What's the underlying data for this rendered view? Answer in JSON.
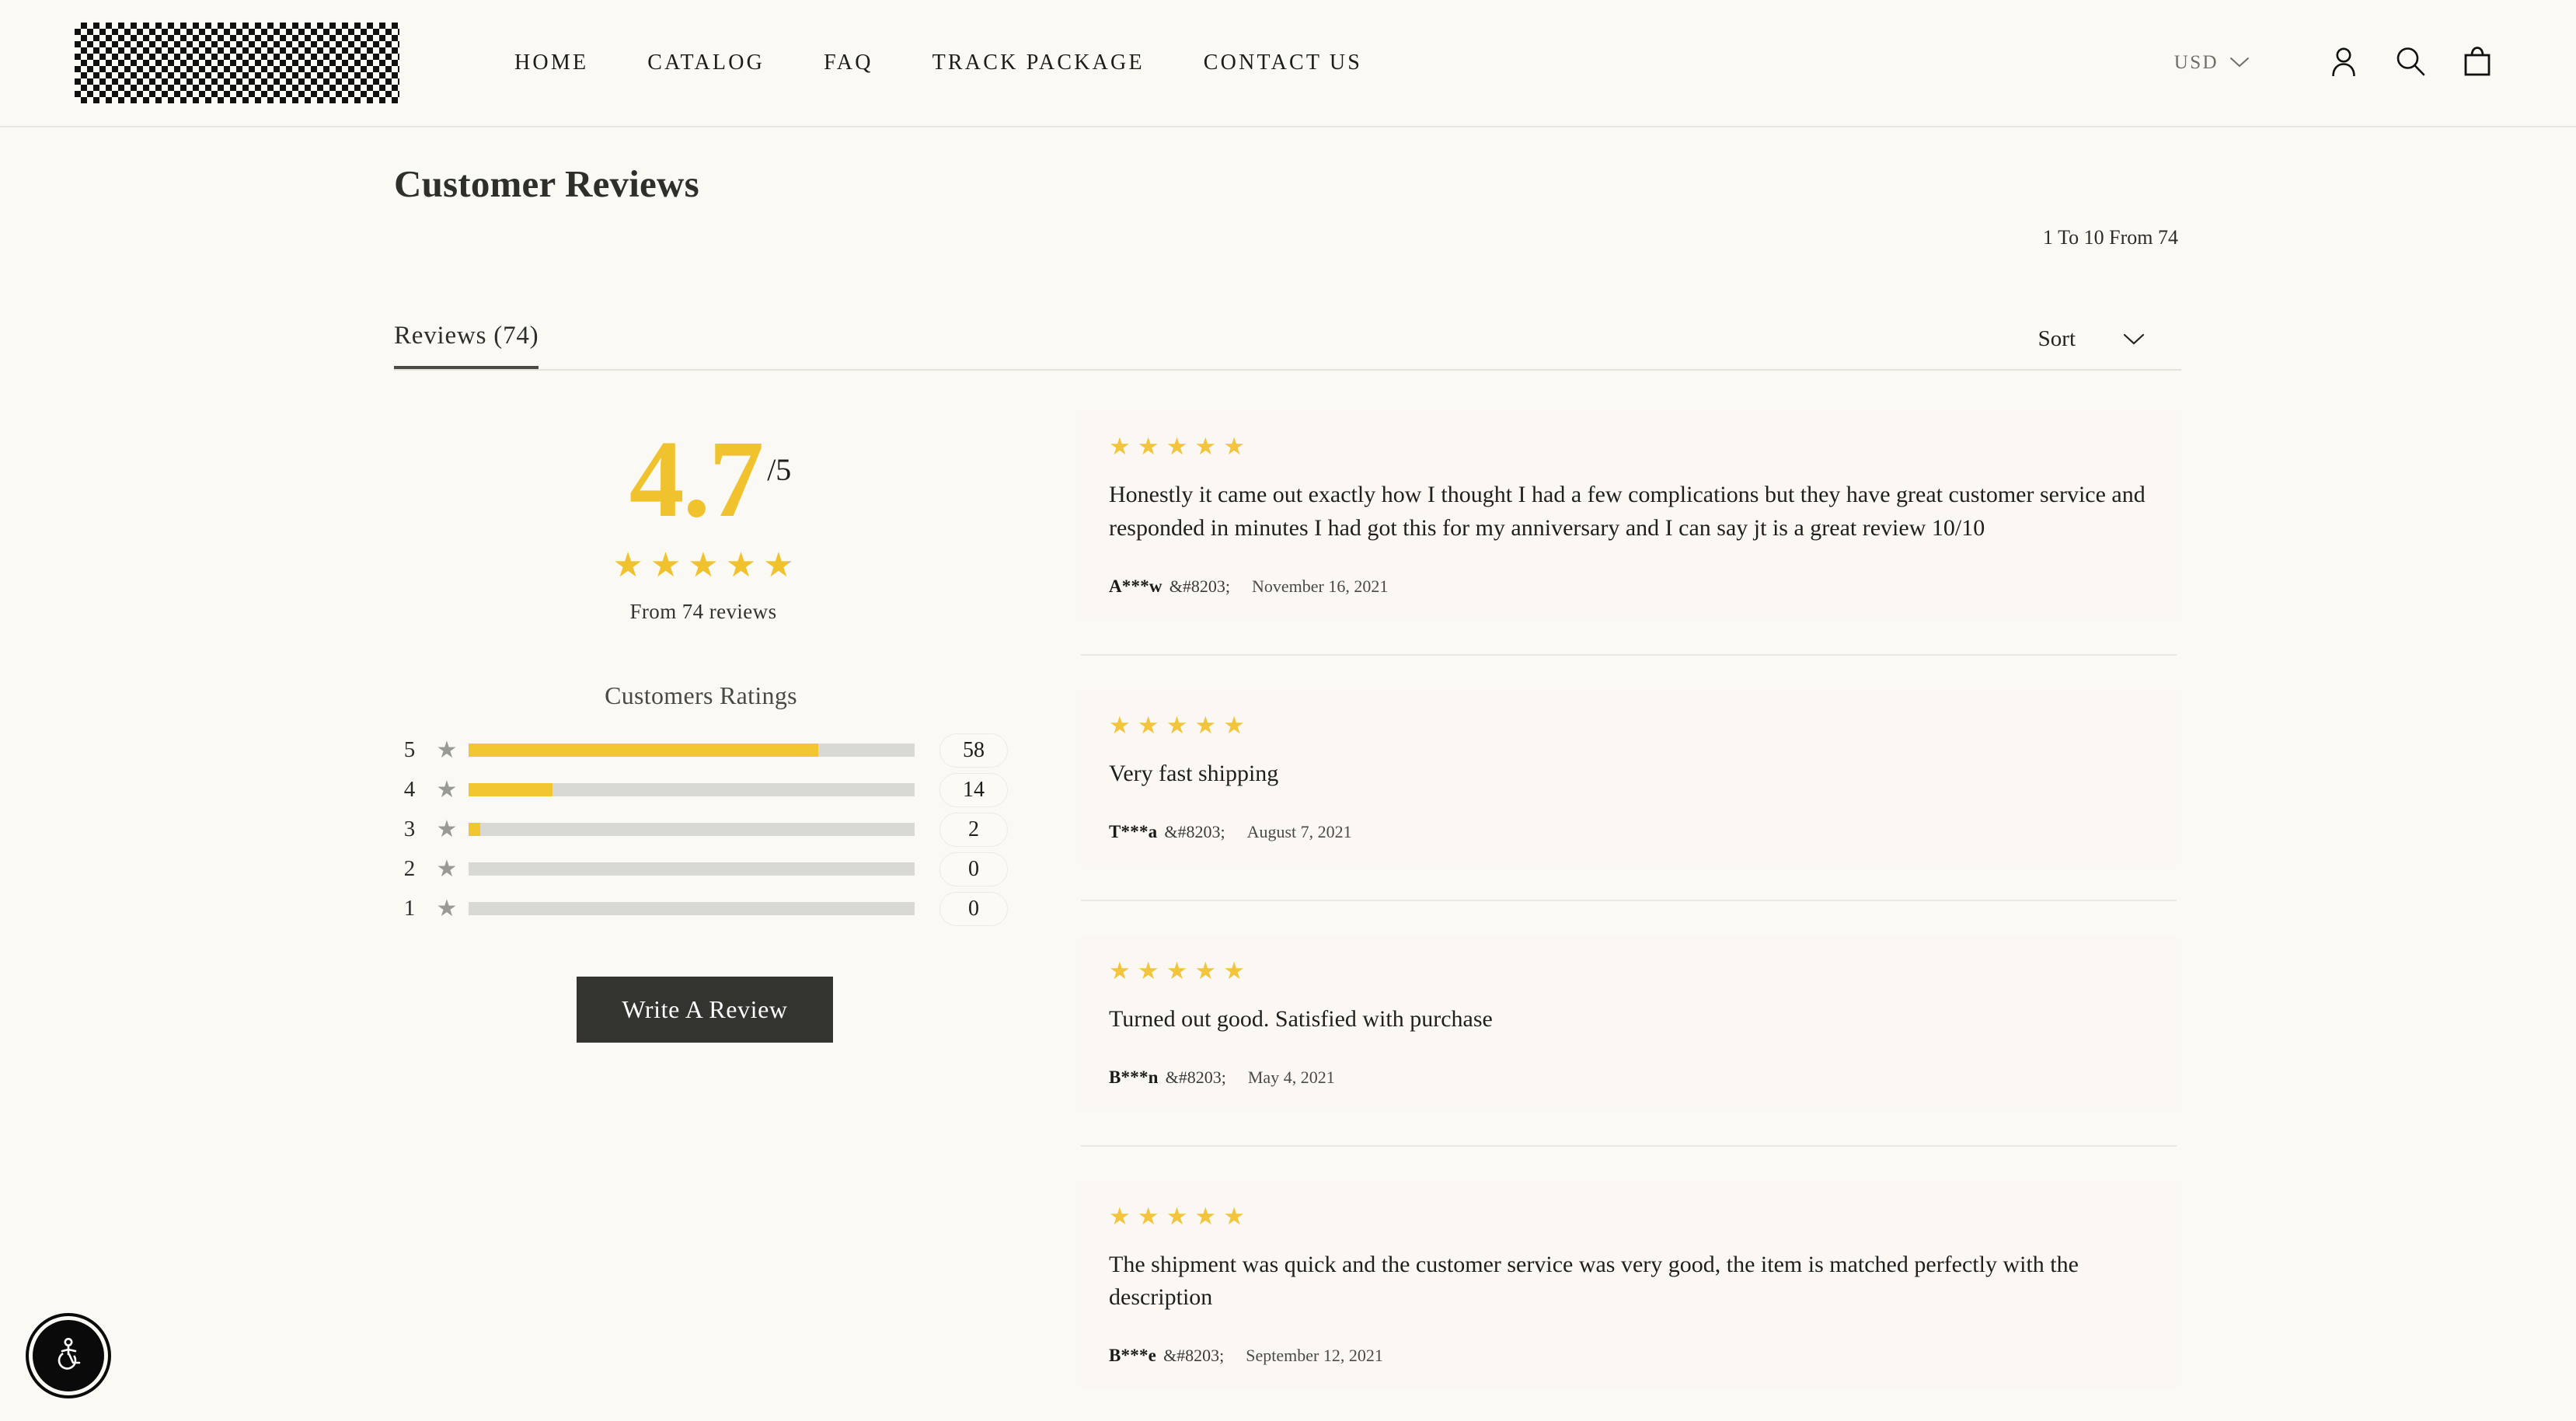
{
  "header": {
    "logo_alt": "store-logo",
    "nav": [
      {
        "label": "HOME"
      },
      {
        "label": "CATALOG"
      },
      {
        "label": "FAQ"
      },
      {
        "label": "TRACK PACKAGE"
      },
      {
        "label": "CONTACT US"
      }
    ],
    "currency": "USD",
    "icons": {
      "account": "account-icon",
      "search": "search-icon",
      "cart": "shopping-bag-icon",
      "chevron": "chevron-down-icon"
    }
  },
  "page": {
    "title": "Customer Reviews",
    "pagination_label": "1 To 10 From 74",
    "tab_label": "Reviews (74)",
    "sort_label": "Sort"
  },
  "summary": {
    "score": "4.7",
    "denominator": "/5",
    "stars_filled": 4,
    "stars_partial_pct": 80,
    "from_reviews": "From 74 reviews",
    "ratings_title": "Customers Ratings",
    "breakdown": [
      {
        "stars": "5",
        "count": "58",
        "pct": 78.4
      },
      {
        "stars": "4",
        "count": "14",
        "pct": 18.9
      },
      {
        "stars": "3",
        "count": "2",
        "pct": 2.7
      },
      {
        "stars": "2",
        "count": "0",
        "pct": 0
      },
      {
        "stars": "1",
        "count": "0",
        "pct": 0
      }
    ],
    "write_review_label": "Write A Review"
  },
  "reviews": [
    {
      "rating": 5,
      "text": "Honestly it came out exactly how I thought I had a few complications but they have great customer service and responded in minutes I had got this for my anniversary and I can say jt is a great review 10/10",
      "author": "A***w",
      "zwsp": "&#8203;",
      "date": "November 16, 2021"
    },
    {
      "rating": 5,
      "text": "Very fast shipping",
      "author": "T***a",
      "zwsp": "&#8203;",
      "date": "August 7, 2021"
    },
    {
      "rating": 5,
      "text": "Turned out good. Satisfied with purchase",
      "author": "B***n",
      "zwsp": "&#8203;",
      "date": "May 4, 2021"
    },
    {
      "rating": 5,
      "text": "The shipment was quick and the customer service was very good, the item is matched perfectly with the description",
      "author": "B***e",
      "zwsp": "&#8203;",
      "date": "September 12, 2021"
    }
  ],
  "accessibility_widget": {
    "icon": "accessibility-icon"
  },
  "colors": {
    "page_bg": "#FAF9F3",
    "card_bg": "#FBF8F4",
    "star_gold": "#F2C53D",
    "score_gold": "#F0C22E",
    "bar_track": "#D8D8D5",
    "button_dark": "#333330",
    "text_dark": "#1F1F1C"
  }
}
